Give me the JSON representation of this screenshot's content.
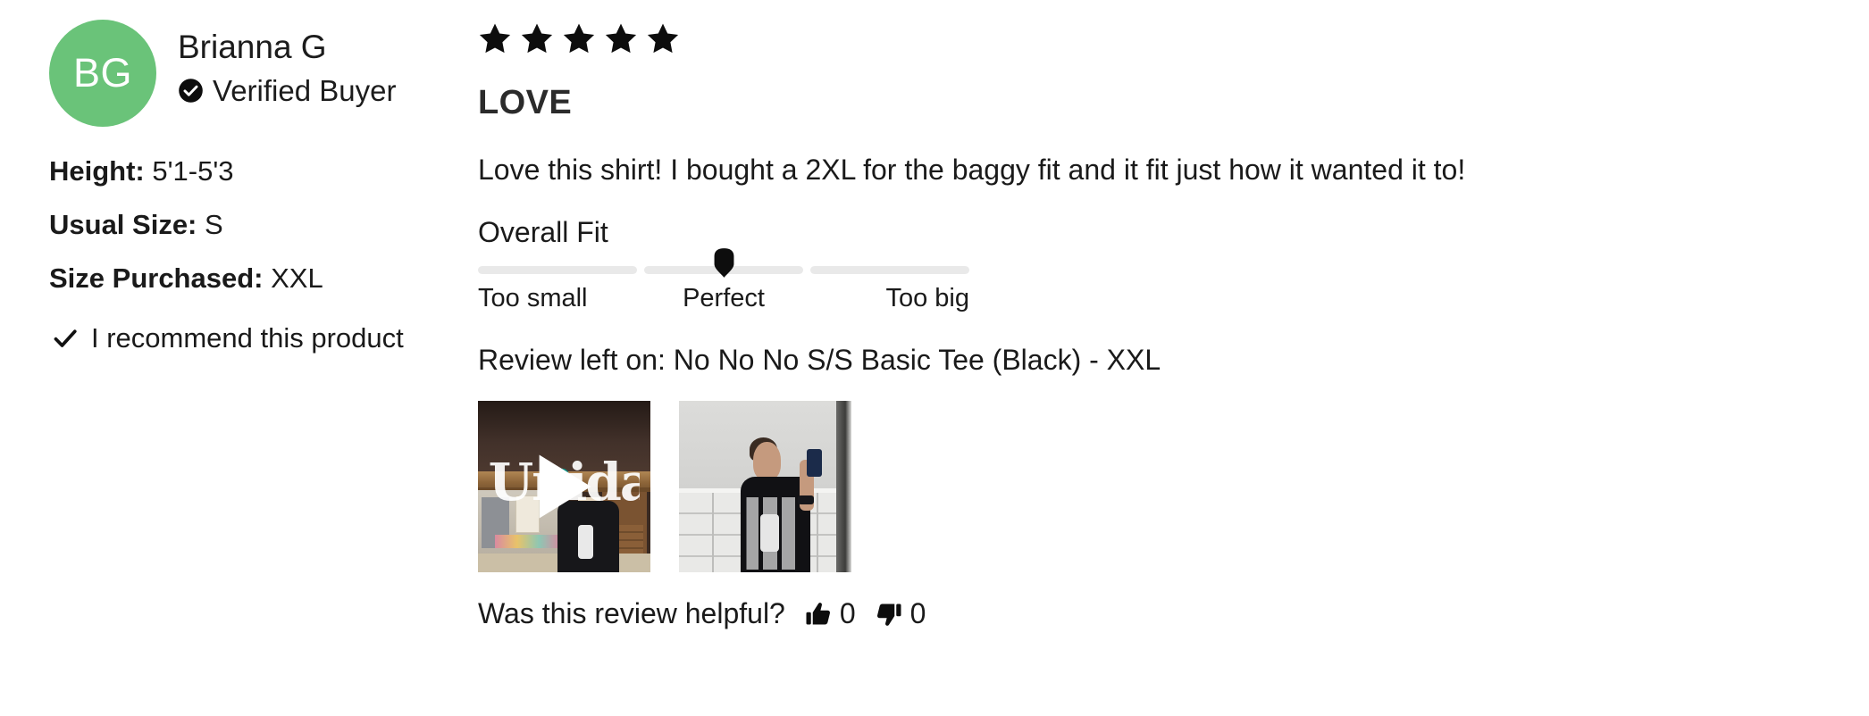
{
  "reviewer": {
    "avatar_initials": "BG",
    "avatar_color": "#6ac379",
    "name": "Brianna G",
    "verified_label": "Verified Buyer",
    "verified_icon": "check-circle-icon",
    "attributes": [
      {
        "label": "Height:",
        "value": "5'1-5'3"
      },
      {
        "label": "Usual Size:",
        "value": "S"
      },
      {
        "label": "Size Purchased:",
        "value": "XXL"
      }
    ],
    "recommend_icon": "check-icon",
    "recommend_text": "I recommend this product"
  },
  "review": {
    "rating": 5,
    "max_rating": 5,
    "star_icon": "star-filled-icon",
    "title": "LOVE",
    "body": "Love this shirt! I bought a 2XL for the baggy fit and it fit just how it wanted it to!",
    "fit": {
      "heading": "Overall Fit",
      "segments": 3,
      "marker_position_percent": 50,
      "marker_icon": "fit-marker-icon",
      "labels": {
        "start": "Too small",
        "middle": "Perfect",
        "end": "Too big"
      }
    },
    "left_on": {
      "label": "Review left on:",
      "product": "No No No S/S Basic Tee (Black) - XXL"
    },
    "media": [
      {
        "type": "video",
        "alt": "Video of reviewer wearing black graphic tee in a shop",
        "play_icon": "play-icon",
        "overlay_text": "Uniday"
      },
      {
        "type": "image",
        "alt": "Mirror selfie of reviewer wearing black graphic tee"
      }
    ],
    "helpful": {
      "question": "Was this review helpful?",
      "up_icon": "thumbs-up-icon",
      "up_count": "0",
      "down_icon": "thumbs-down-icon",
      "down_count": "0"
    }
  }
}
